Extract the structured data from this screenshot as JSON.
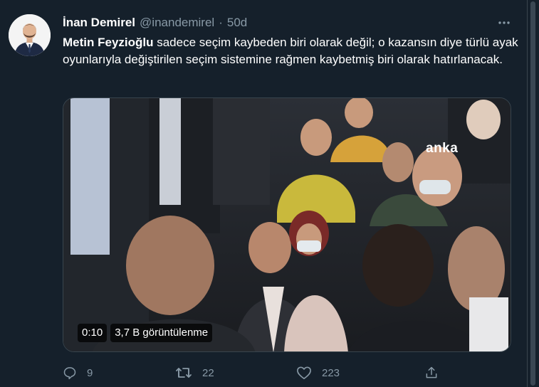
{
  "tweet": {
    "author_name": "İnan Demirel",
    "handle": "@inandemirel",
    "separator": "·",
    "time": "50d",
    "more_icon": "more-horizontal-icon",
    "text_bold": "Metin Feyzioğlu",
    "text_rest": " sadece seçim kaybeden biri olarak değil; o kazansın diye türlü ayak oyunlarıyla değiştirilen seçim sistemine rağmen kaybetmiş biri olarak hatırlanacak."
  },
  "media": {
    "watermark": "anka",
    "duration": "0:10",
    "views": "3,7 B görüntülenme"
  },
  "actions": {
    "reply_count": "9",
    "retweet_count": "22",
    "like_count": "223",
    "share_icon": "share-icon"
  },
  "colors": {
    "background": "#15202b",
    "muted_text": "#8899a6",
    "border": "#38444d"
  }
}
